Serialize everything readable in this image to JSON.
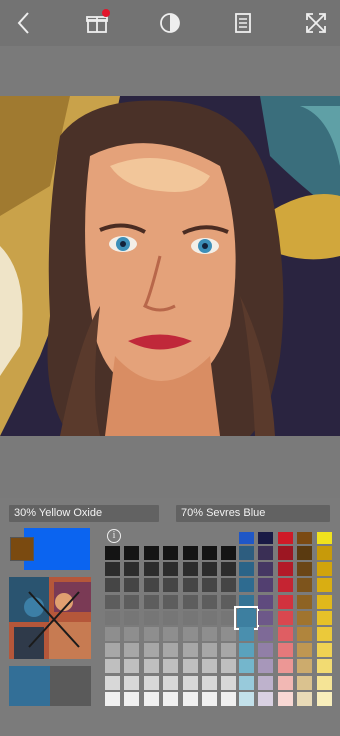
{
  "toolbar": {
    "icons": [
      "back-arrow-icon",
      "gift-box-icon",
      "contrast-icon",
      "book-icon",
      "expand-icon"
    ],
    "notification_color": "#e3152b"
  },
  "mix": {
    "left_label": "30% Yellow Oxide",
    "right_label": "70% Sevres Blue",
    "color_a": "#0b64f0",
    "color_b": "#7a4a10",
    "compare_left": "#336f97",
    "compare_right": "#5a5a5a"
  },
  "info_glyph": "i",
  "palette": {
    "columns": 7,
    "rows": 10,
    "hue_headers": [
      "#1f57c7",
      "#191a45",
      "#cf1a27",
      "#7b4a12",
      "#f0e21e"
    ],
    "hue_columns": [
      [
        "#2d5d7f",
        "#2b6488",
        "#2e6b90",
        "#347395",
        "#3d7fa0",
        "#4a8fae",
        "#5aa2bd",
        "#74b6cc",
        "#98cadb",
        "#c3e1ea"
      ],
      [
        "#3a2f55",
        "#453763",
        "#523f70",
        "#5f4a7e",
        "#6d5889",
        "#7e6a97",
        "#917fa7",
        "#a797ba",
        "#beb2cc",
        "#d9d1e2"
      ],
      [
        "#9c1622",
        "#b31a28",
        "#c52432",
        "#d2323e",
        "#d9474f",
        "#df5e63",
        "#e5797b",
        "#ec9795",
        "#f2b8b4",
        "#f8d8d4"
      ],
      [
        "#5a3a10",
        "#6b4616",
        "#7d541c",
        "#8e6323",
        "#a0742e",
        "#b0853d",
        "#bf9752",
        "#ccab6d",
        "#dac28f",
        "#e8dab7"
      ],
      [
        "#c79a0a",
        "#d1a40c",
        "#d9ae12",
        "#e0b81b",
        "#e6c128",
        "#ebc93a",
        "#efd253",
        "#f2db72",
        "#f5e496",
        "#f8eebb"
      ]
    ],
    "selected": {
      "col": 0,
      "row": 4
    }
  }
}
